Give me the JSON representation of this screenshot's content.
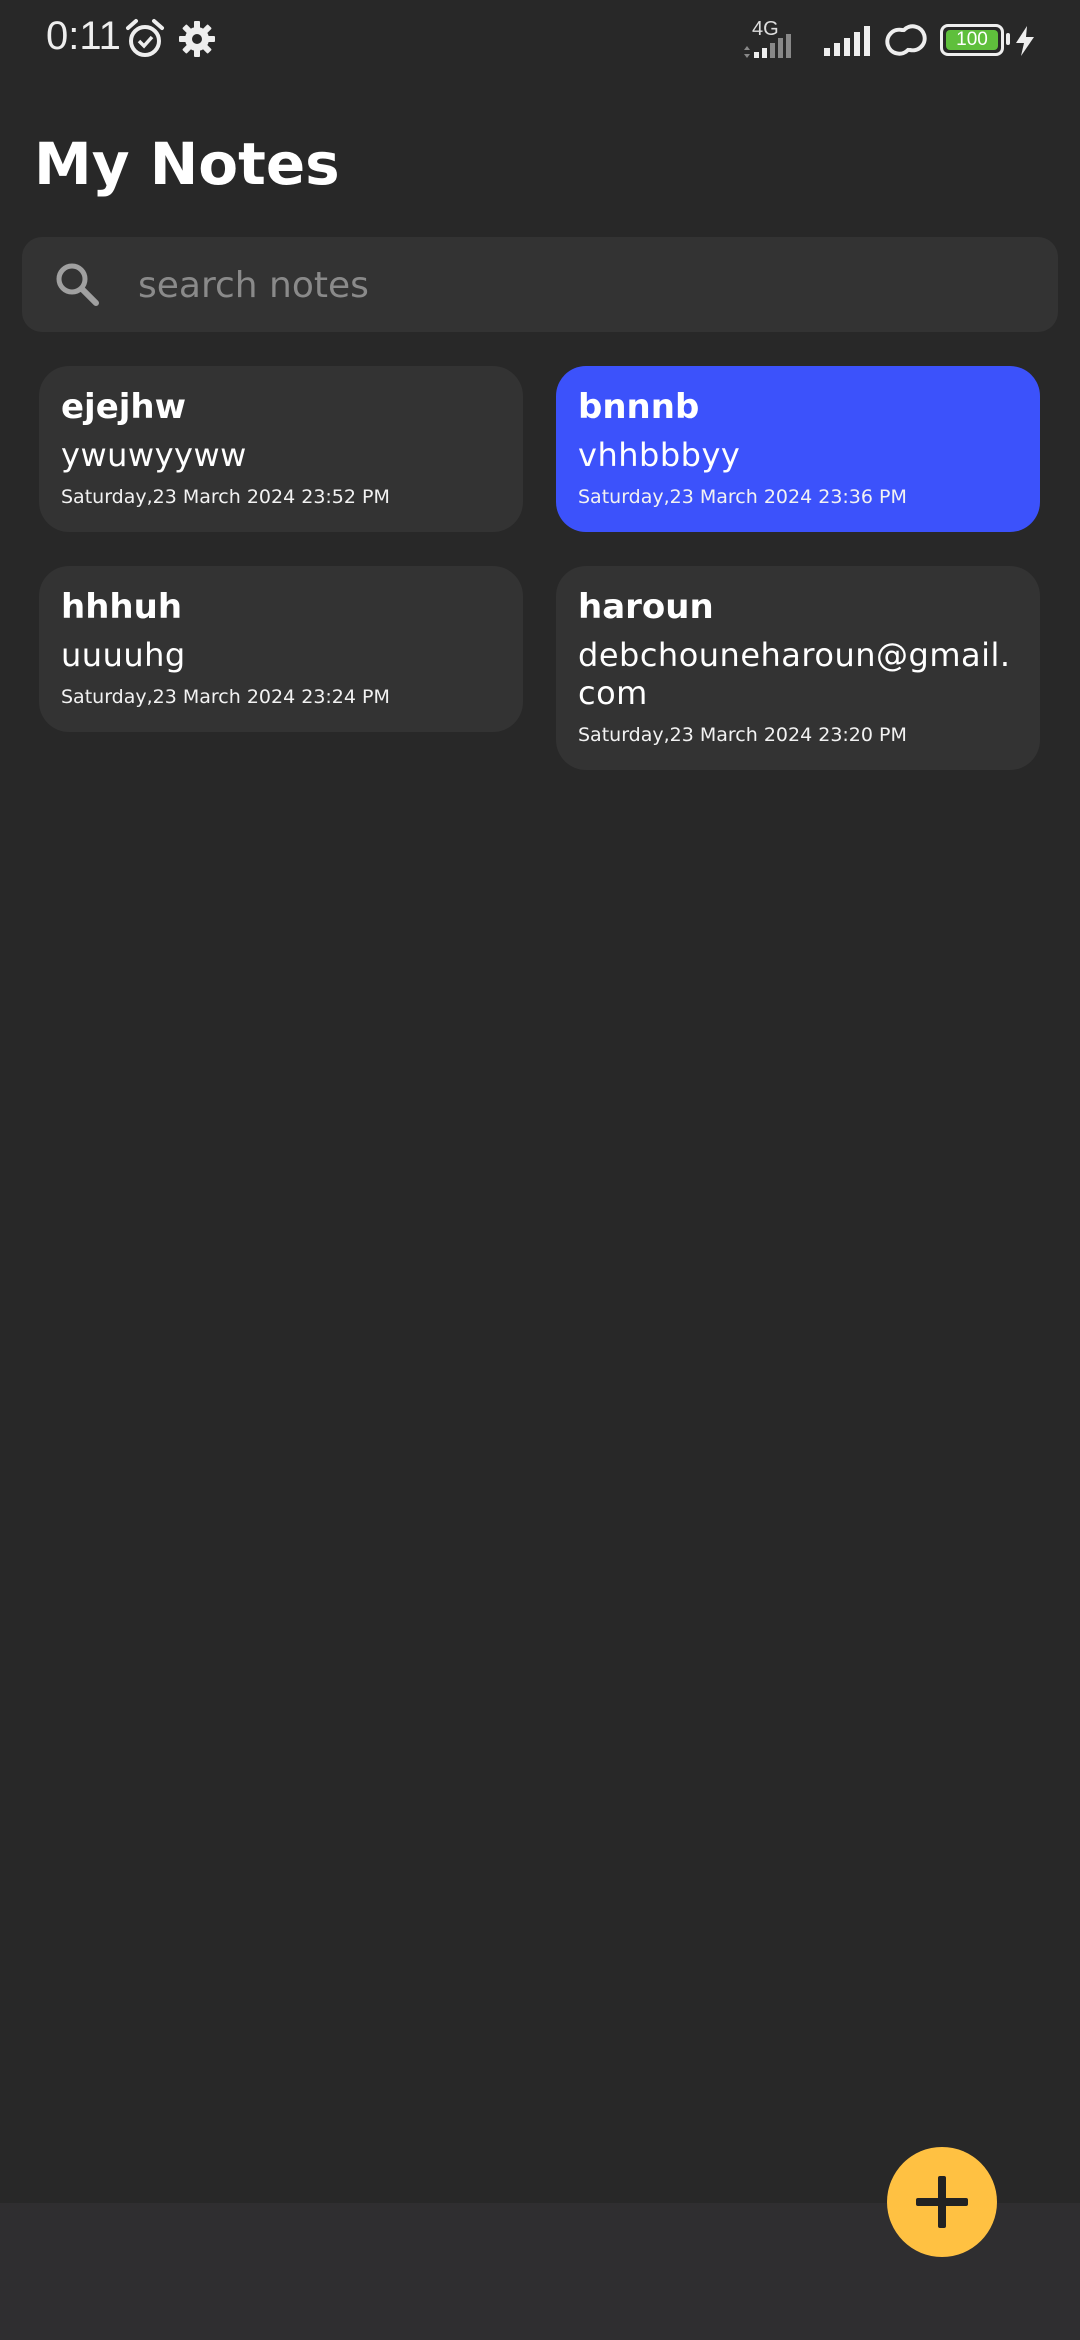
{
  "status_bar": {
    "time": "0:11",
    "network_type": "4G",
    "battery": "100",
    "icons": [
      "alarm-icon",
      "gear-icon",
      "signal-icon",
      "link-icon",
      "battery-icon",
      "charging-icon"
    ]
  },
  "header": {
    "title": "My Notes"
  },
  "search": {
    "placeholder": "search notes",
    "value": ""
  },
  "notes": [
    {
      "title": "ejejhw",
      "body": "ywuwyyww",
      "date": "Saturday,23 March 2024 23:52 PM",
      "selected": false
    },
    {
      "title": "bnnnb",
      "body": "vhhbbbyy",
      "date": "Saturday,23 March 2024 23:36 PM",
      "selected": true
    },
    {
      "title": "hhhuh",
      "body": "uuuuhg",
      "date": "Saturday,23 March 2024 23:24 PM",
      "selected": false
    },
    {
      "title": "haroun",
      "body": "debchouneharoun@gmail.com",
      "date": "Saturday,23 March 2024 23:20 PM",
      "selected": false
    }
  ],
  "fab": {
    "icon": "plus-icon"
  },
  "colors": {
    "background": "#282828",
    "card": "#333333",
    "selected_card": "#3c52fb",
    "fab": "#ffc142",
    "bottom_bar": "#2f2e30"
  }
}
